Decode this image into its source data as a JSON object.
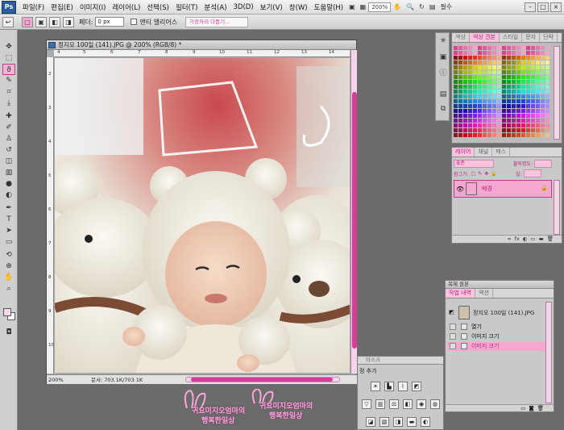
{
  "app": {
    "logo": "Ps"
  },
  "menu": {
    "items": [
      "파일(F)",
      "편집(E)",
      "이미지(I)",
      "레이어(L)",
      "선택(S)",
      "필터(T)",
      "분석(A)",
      "3D(D)",
      "보기(V)",
      "창(W)",
      "도움말(H)"
    ],
    "zoom": "200%",
    "essentials": "필수",
    "window_controls": [
      "–",
      "□",
      "×"
    ]
  },
  "options": {
    "feather_label": "페더:",
    "feather_value": "0 px",
    "antialias_label": "앤티 앨리어스",
    "style_value": "가장자리 다듬기..."
  },
  "document": {
    "title": "정지오 100일 (141).JPG @ 200% (RGB/8) *",
    "zoom_status": "200%",
    "doc_info": "문서: 703.1K/703.1K",
    "ruler_top_labels": [
      "4",
      "5",
      "6",
      "7",
      "8",
      "9",
      "10",
      "11",
      "12",
      "13",
      "14"
    ],
    "ruler_left_labels": [
      "2",
      "3",
      "4",
      "5",
      "6",
      "7",
      "8",
      "9",
      "10"
    ]
  },
  "swatches": {
    "tabs": [
      "색상",
      "색상 견본",
      "스타일",
      "문자",
      "단락"
    ],
    "active_tab": 1
  },
  "layers": {
    "tabs": [
      "레이어",
      "채널",
      "패스"
    ],
    "blend_mode": "표준",
    "opacity_label": "불투명도:",
    "lock_label": "잠그기:",
    "fill_label": "칠:",
    "layer_name": "배경",
    "footer_icons": [
      "∞",
      "fx",
      "◐",
      "▭",
      "▬",
      "🗑"
    ]
  },
  "history": {
    "header": "복제 원본",
    "tabs": [
      "작업 내역",
      "액션"
    ],
    "snapshot": "정지오 100일 (141).JPG",
    "steps": [
      "열기",
      "이미지 크기",
      "이미지 크기"
    ],
    "active_step": 2
  },
  "styles_panel": {
    "tabs": "마스크",
    "add_label": "정 추가"
  },
  "watermark": {
    "lines": [
      "귀요미지오엄마의",
      "행복한일상"
    ]
  }
}
